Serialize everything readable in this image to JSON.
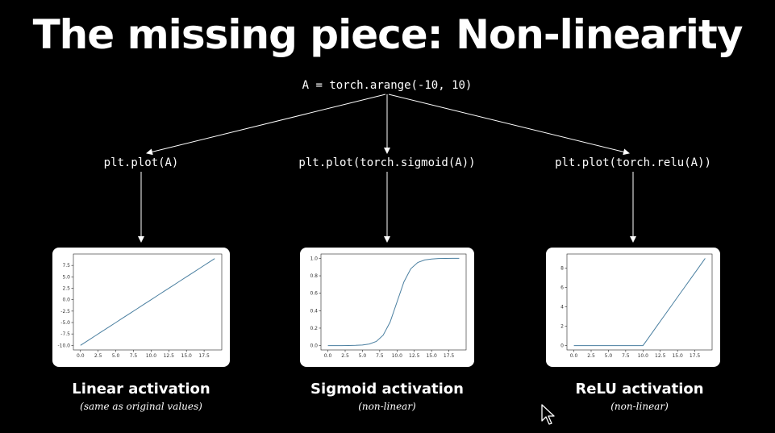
{
  "title": "The missing piece: Non-linearity",
  "root_code": "A = torch.arange(-10, 10)",
  "branches": [
    {
      "code": "plt.plot(A)",
      "label": "Linear activation",
      "sublabel": "(same as original values)"
    },
    {
      "code": "plt.plot(torch.sigmoid(A))",
      "label": "Sigmoid activation",
      "sublabel": "(non-linear)"
    },
    {
      "code": "plt.plot(torch.relu(A))",
      "label": "ReLU activation",
      "sublabel": "(non-linear)"
    }
  ],
  "colors": {
    "background": "#000000",
    "line": "#4a7fa0",
    "card": "#ffffff"
  },
  "chart_data": [
    {
      "type": "line",
      "x": [
        0,
        1,
        2,
        3,
        4,
        5,
        6,
        7,
        8,
        9,
        10,
        11,
        12,
        13,
        14,
        15,
        16,
        17,
        18,
        19
      ],
      "values": [
        -10,
        -9,
        -8,
        -7,
        -6,
        -5,
        -4,
        -3,
        -2,
        -1,
        0,
        1,
        2,
        3,
        4,
        5,
        6,
        7,
        8,
        9
      ],
      "xlim": [
        -1,
        20
      ],
      "ylim": [
        -11,
        10
      ],
      "xticks": [
        0.0,
        2.5,
        5.0,
        7.5,
        10.0,
        12.5,
        15.0,
        17.5
      ],
      "xtick_labels": [
        "0.0",
        "2.5",
        "5.0",
        "7.5",
        "10.0",
        "12.5",
        "15.0",
        "17.5"
      ],
      "yticks": [
        -10.0,
        -7.5,
        -5.0,
        -2.5,
        0.0,
        2.5,
        5.0,
        7.5
      ],
      "ytick_labels": [
        "-10.0",
        "-7.5",
        "-5.0",
        "-2.5",
        "0.0",
        "2.5",
        "5.0",
        "7.5"
      ]
    },
    {
      "type": "line",
      "x": [
        0,
        1,
        2,
        3,
        4,
        5,
        6,
        7,
        8,
        9,
        10,
        11,
        12,
        13,
        14,
        15,
        16,
        17,
        18,
        19
      ],
      "values": [
        4.54e-05,
        0.000123,
        0.000335,
        0.000911,
        0.00247,
        0.00669,
        0.018,
        0.0474,
        0.119,
        0.269,
        0.5,
        0.731,
        0.881,
        0.953,
        0.982,
        0.993,
        0.998,
        0.999,
        1.0,
        1.0
      ],
      "xlim": [
        -1,
        20
      ],
      "ylim": [
        -0.05,
        1.05
      ],
      "xticks": [
        0.0,
        2.5,
        5.0,
        7.5,
        10.0,
        12.5,
        15.0,
        17.5
      ],
      "xtick_labels": [
        "0.0",
        "2.5",
        "5.0",
        "7.5",
        "10.0",
        "12.5",
        "15.0",
        "17.5"
      ],
      "yticks": [
        0.0,
        0.2,
        0.4,
        0.6,
        0.8,
        1.0
      ],
      "ytick_labels": [
        "0.0",
        "0.2",
        "0.4",
        "0.6",
        "0.8",
        "1.0"
      ]
    },
    {
      "type": "line",
      "x": [
        0,
        1,
        2,
        3,
        4,
        5,
        6,
        7,
        8,
        9,
        10,
        11,
        12,
        13,
        14,
        15,
        16,
        17,
        18,
        19
      ],
      "values": [
        0,
        0,
        0,
        0,
        0,
        0,
        0,
        0,
        0,
        0,
        0,
        1,
        2,
        3,
        4,
        5,
        6,
        7,
        8,
        9
      ],
      "xlim": [
        -1,
        20
      ],
      "ylim": [
        -0.45,
        9.45
      ],
      "xticks": [
        0.0,
        2.5,
        5.0,
        7.5,
        10.0,
        12.5,
        15.0,
        17.5
      ],
      "xtick_labels": [
        "0.0",
        "2.5",
        "5.0",
        "7.5",
        "10.0",
        "12.5",
        "15.0",
        "17.5"
      ],
      "yticks": [
        0,
        2,
        4,
        6,
        8
      ],
      "ytick_labels": [
        "0",
        "2",
        "4",
        "6",
        "8"
      ]
    }
  ]
}
